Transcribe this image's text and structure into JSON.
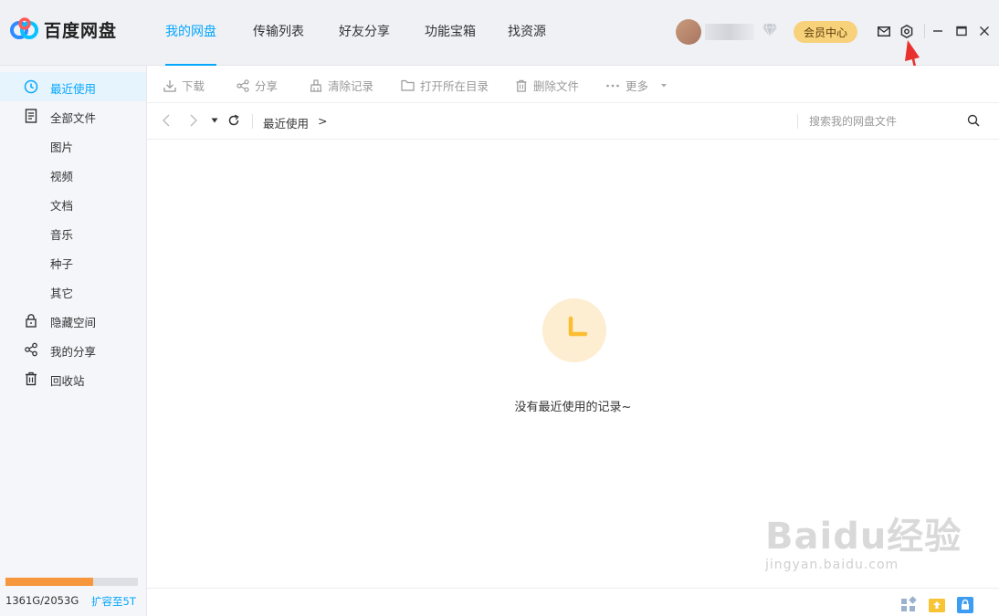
{
  "app": {
    "name": "百度网盘"
  },
  "nav": {
    "tabs": [
      {
        "label": "我的网盘",
        "active": true
      },
      {
        "label": "传输列表",
        "active": false
      },
      {
        "label": "好友分享",
        "active": false
      },
      {
        "label": "功能宝箱",
        "active": false
      },
      {
        "label": "找资源",
        "active": false
      }
    ]
  },
  "header": {
    "vip_label": "会员中心",
    "icons": [
      "mail-icon",
      "settings-icon",
      "minimize-icon",
      "maximize-icon",
      "close-icon"
    ]
  },
  "sidebar": {
    "items": [
      {
        "label": "最近使用",
        "icon": "clock-icon",
        "active": true
      },
      {
        "label": "全部文件",
        "icon": "file-icon",
        "active": false
      },
      {
        "label": "图片",
        "icon": "",
        "active": false
      },
      {
        "label": "视频",
        "icon": "",
        "active": false
      },
      {
        "label": "文档",
        "icon": "",
        "active": false
      },
      {
        "label": "音乐",
        "icon": "",
        "active": false
      },
      {
        "label": "种子",
        "icon": "",
        "active": false
      },
      {
        "label": "其它",
        "icon": "",
        "active": false
      },
      {
        "label": "隐藏空间",
        "icon": "lock-icon",
        "active": false
      },
      {
        "label": "我的分享",
        "icon": "share-icon",
        "active": false
      },
      {
        "label": "回收站",
        "icon": "trash-icon",
        "active": false
      }
    ],
    "storage": {
      "used_text": "1361G/2053G",
      "used_fraction": 0.663,
      "expand_label": "扩容至5T"
    }
  },
  "toolbar": {
    "download": "下载",
    "share": "分享",
    "clear_records": "清除记录",
    "open_folder": "打开所在目录",
    "delete_file": "删除文件",
    "more": "更多"
  },
  "pathbar": {
    "crumb": "最近使用",
    "crumb_sep": ">",
    "search_placeholder": "搜索我的网盘文件"
  },
  "main": {
    "empty_text": "没有最近使用的记录~"
  },
  "watermark": {
    "main": "Baidu经验",
    "sub": "jingyan.baidu.com"
  },
  "colors": {
    "accent": "#06a7ff",
    "vip": "#f8d27a",
    "storage": "#f6963d",
    "annotation": "#e8312c"
  }
}
